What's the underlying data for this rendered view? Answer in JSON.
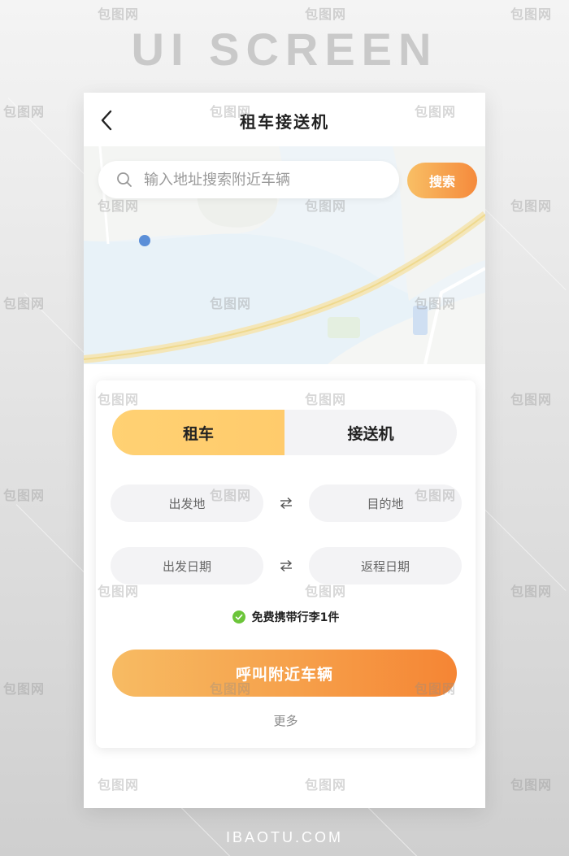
{
  "poster": {
    "title": "UI SCREEN",
    "footer": "IBAOTU.COM",
    "watermark": "包图网"
  },
  "nav": {
    "title": "租车接送机",
    "back_icon": "chevron-left-icon"
  },
  "search": {
    "placeholder": "输入地址搜索附近车辆",
    "button_label": "搜索",
    "icon": "search-icon"
  },
  "tabs": [
    {
      "label": "租车",
      "active": true
    },
    {
      "label": "接送机",
      "active": false
    }
  ],
  "route": {
    "from": "出发地",
    "to": "目的地",
    "swap_icon": "swap-arrows-icon"
  },
  "dates": {
    "depart": "出发日期",
    "return": "返程日期",
    "swap_icon": "swap-arrows-icon"
  },
  "luggage": {
    "text": "免费携带行李1件",
    "icon": "check-circle-icon"
  },
  "actions": {
    "call_label": "呼叫附近车辆",
    "more_label": "更多"
  },
  "colors": {
    "accent_start": "#f8bf65",
    "accent_end": "#f58534",
    "tab_active": "#ffcf70",
    "check": "#6cc53a"
  }
}
